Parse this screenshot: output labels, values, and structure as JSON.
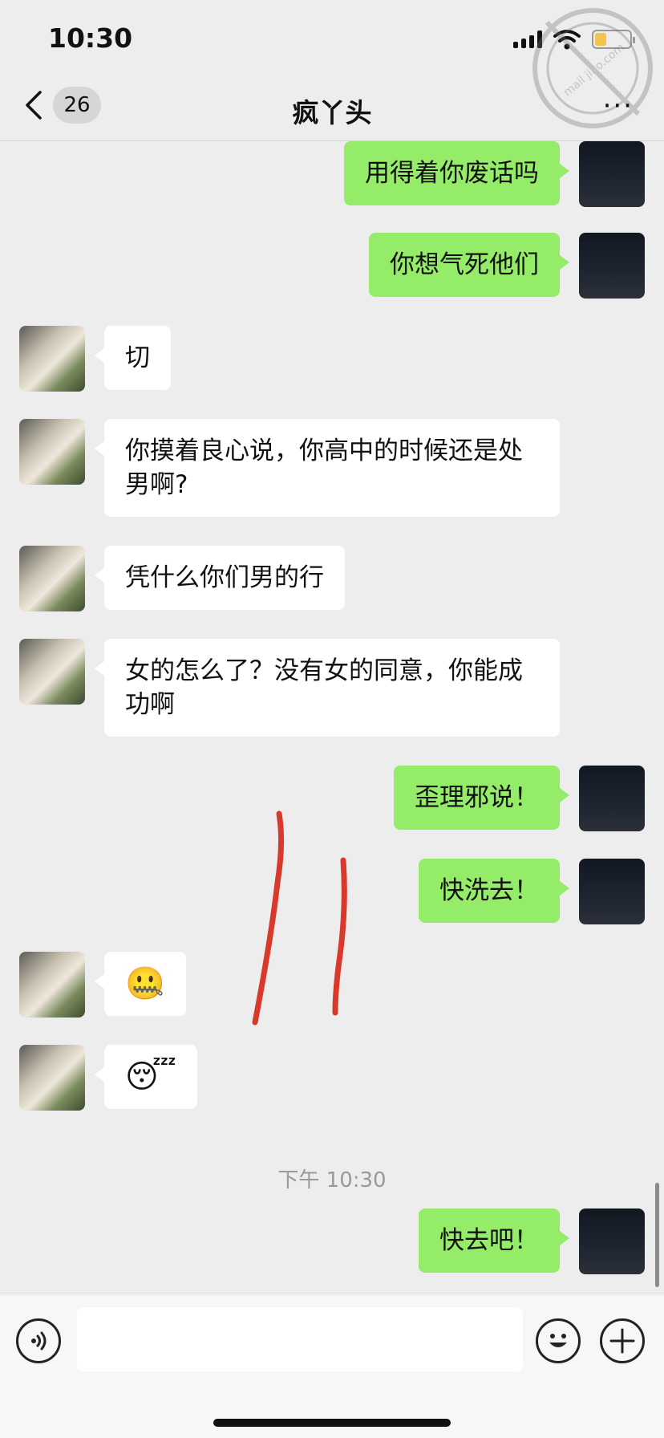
{
  "status_bar": {
    "time": "10:30"
  },
  "nav": {
    "unread_count": "26",
    "title": "疯丫头",
    "more": "···"
  },
  "messages": [
    {
      "side": "right",
      "type": "text",
      "text": "用得着你废话吗"
    },
    {
      "side": "right",
      "type": "text",
      "text": "你想气死他们"
    },
    {
      "side": "left",
      "type": "text",
      "text": "切"
    },
    {
      "side": "left",
      "type": "text",
      "text": "你摸着良心说，你高中的时候还是处男啊?"
    },
    {
      "side": "left",
      "type": "text",
      "text": "凭什么你们男的行"
    },
    {
      "side": "left",
      "type": "text",
      "text": "女的怎么了？没有女的同意，你能成功啊"
    },
    {
      "side": "right",
      "type": "text",
      "text": "歪理邪说！"
    },
    {
      "side": "right",
      "type": "text",
      "text": "快洗去！"
    },
    {
      "side": "left",
      "type": "emoji",
      "text": "🤐"
    },
    {
      "side": "left",
      "type": "emoji",
      "text": "😴"
    },
    {
      "side": "right",
      "type": "text",
      "text": "快去吧！"
    }
  ],
  "timestamp": "下午 10:30",
  "watermark_text": "mail jiao.com",
  "colors": {
    "background": "#ededed",
    "bubble_sent": "#95ec69",
    "bubble_received": "#ffffff",
    "annotation_red": "#d8392b"
  },
  "icons": {
    "back": "chevron-left-icon",
    "voice": "voice-icon",
    "emoji": "smiley-icon",
    "plus": "plus-icon"
  }
}
